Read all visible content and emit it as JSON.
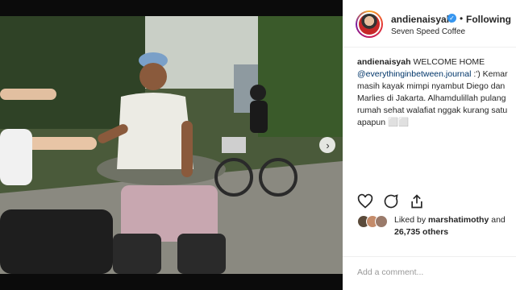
{
  "post": {
    "username": "andienaisyah",
    "follow_label": "Following",
    "separator": "•",
    "location": "Seven Speed Coffee",
    "caption": {
      "username": "andienaisyah",
      "line1_text": " WELCOME HOME",
      "mention": "@everythinginbetween.journal",
      "line2_text": " :') Kemar",
      "line3": "masih kayak mimpi nyambut Diego dan",
      "line4": "Marlies di Jakarta. Alhamdulillah pulang",
      "line5": "rumah sehat walafiat nggak kurang satu",
      "line6": "apapun ⬜⬜"
    },
    "likes": {
      "prefix": "Liked by ",
      "user": "marshatimothy",
      "and": " and",
      "count": "26,735 others"
    },
    "comment_placeholder": "Add a comment..."
  },
  "icons": {
    "verified": "verified-badge-icon",
    "like": "heart-icon",
    "comment": "comment-icon",
    "share": "share-icon",
    "next": "chevron-right-icon"
  },
  "colors": {
    "verified": "#3897f0",
    "text": "#262626",
    "muted": "#999999",
    "mention": "#003569"
  }
}
